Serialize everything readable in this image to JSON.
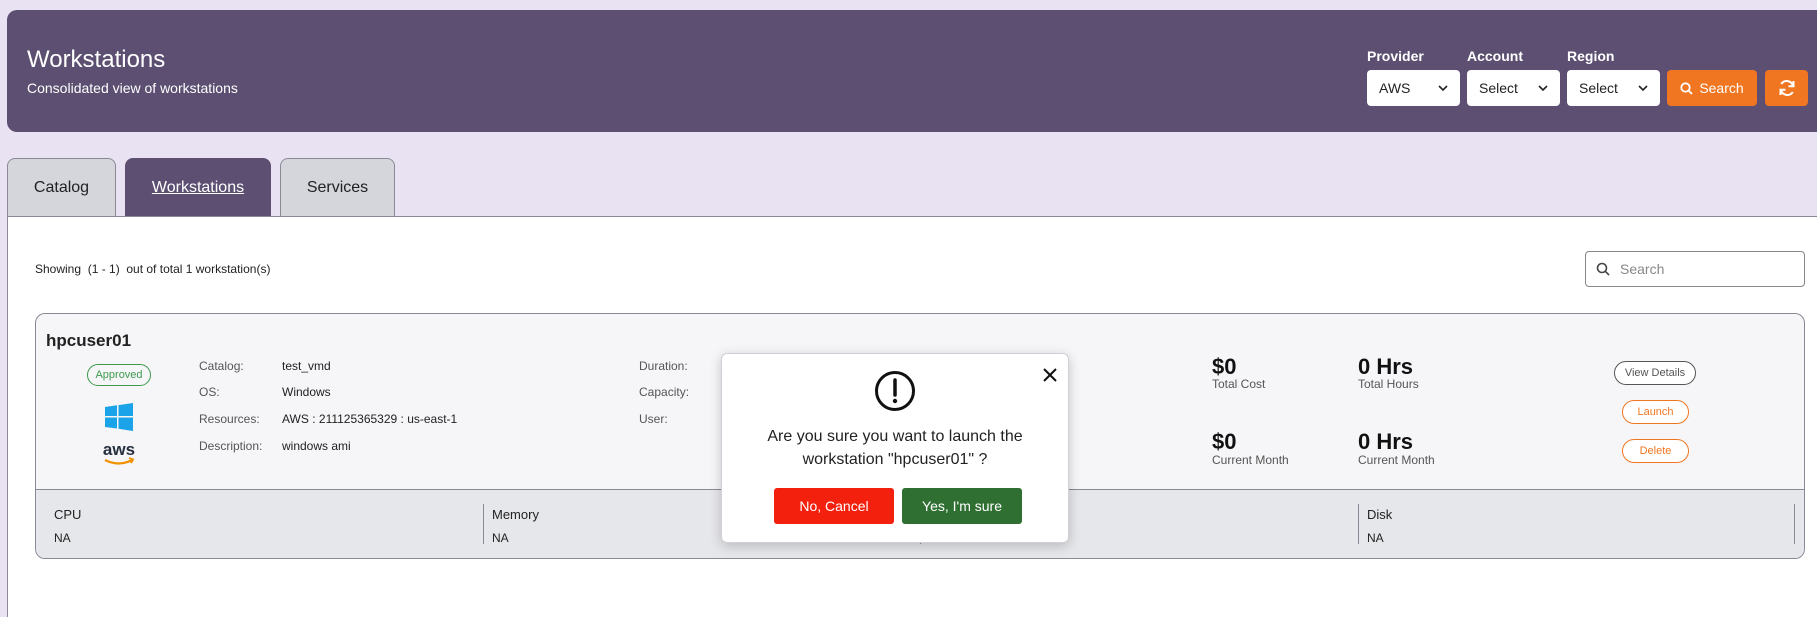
{
  "header": {
    "title": "Workstations",
    "subtitle": "Consolidated view of workstations",
    "filters": [
      {
        "label": "Provider",
        "value": "AWS"
      },
      {
        "label": "Account",
        "value": "Select"
      },
      {
        "label": "Region",
        "value": "Select"
      }
    ],
    "search_label": "Search"
  },
  "tabs": [
    {
      "label": "Catalog",
      "active": false
    },
    {
      "label": "Workstations",
      "active": true
    },
    {
      "label": "Services",
      "active": false
    }
  ],
  "listing": {
    "showing_text": "Showing  (1 - 1)  out of total 1 workstation(s)",
    "search_placeholder": "Search"
  },
  "card": {
    "name": "hpcuser01",
    "status": "Approved",
    "details": [
      {
        "label": "Catalog:",
        "value": "test_vmd"
      },
      {
        "label": "OS:",
        "value": "Windows"
      },
      {
        "label": "Resources:",
        "value": "AWS : 211125365329 : us-east-1"
      },
      {
        "label": "Description:",
        "value": "windows ami"
      }
    ],
    "usage_labels": [
      "Duration:",
      "Capacity:",
      "User:"
    ],
    "total_cost": {
      "amount": "0",
      "caption": "Total Cost"
    },
    "total_hours": {
      "amount": "0 Hrs",
      "caption": "Total Hours"
    },
    "month_cost": {
      "amount": "0",
      "caption": "Current Month"
    },
    "month_hours": {
      "amount": "0 Hrs",
      "caption": "Current Month"
    },
    "currency": "$",
    "actions": {
      "view": "View Details",
      "launch": "Launch",
      "delete": "Delete"
    },
    "metrics": [
      {
        "label": "CPU",
        "value": "NA"
      },
      {
        "label": "Memory",
        "value": "NA"
      },
      {
        "label": "Disk",
        "value": "NA"
      }
    ]
  },
  "modal": {
    "message_line1": "Are you sure you want to launch the",
    "message_line2": "workstation \"hpcuser01\" ?",
    "cancel_label": "No, Cancel",
    "confirm_label": "Yes, I'm sure"
  },
  "colors": {
    "page_bg": "#e9e2f3",
    "header_bg": "#5c4f71",
    "accent_orange": "#f07621",
    "cancel_red": "#f2200d",
    "confirm_green": "#2f7032",
    "approved_green": "#3c9a4b"
  },
  "icons": [
    "search-icon",
    "refresh-icon",
    "chevron-down-icon",
    "windows-logo-icon",
    "aws-logo-icon",
    "alert-icon",
    "close-icon"
  ]
}
